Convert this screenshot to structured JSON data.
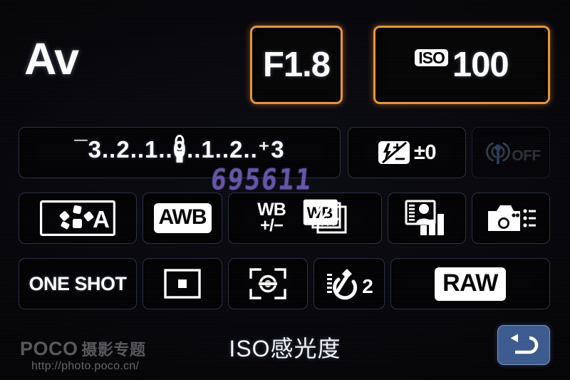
{
  "screen": {
    "device": "camera-quick-control-screen",
    "mode_dial": "Av",
    "accent_highlight_color": "#e8923a",
    "cell_border_color": "#2b3048",
    "background_color": "#000000"
  },
  "exposure": {
    "aperture": "F1.8",
    "iso_badge": "ISO",
    "iso_value": "100",
    "meter_scale": "¯3..2..1..0..1..2..⁺3",
    "meter_index": "0",
    "flash_exposure_compensation": "±0",
    "flash_comp_icon": "flash-exposure-compensation-icon"
  },
  "wireless": {
    "icon": "wifi-icon",
    "status": "OFF"
  },
  "settings_grid": {
    "picture_style": {
      "icon": "picture-style-auto-icon",
      "label": "A"
    },
    "white_balance": {
      "icon": "white-balance-badge",
      "label": "AWB"
    },
    "wb_shift": {
      "icon": "wb-correction-icon",
      "line1": "WB",
      "line2": "+/−"
    },
    "wb_bracket": {
      "icon": "wb-bracketing-icon",
      "label": "WB"
    },
    "auto_lighting_optimizer": {
      "icon": "auto-lighting-optimizer-icon"
    },
    "custom_functions": {
      "icon": "camera-custom-functions-icon"
    },
    "af_mode": {
      "label": "ONE SHOT"
    },
    "af_area": {
      "icon": "single-point-af-icon"
    },
    "metering": {
      "icon": "evaluative-metering-icon"
    },
    "drive_mode": {
      "icon": "self-timer-icon",
      "label": "2"
    },
    "image_quality": {
      "label": "RAW"
    }
  },
  "bottom_bar": {
    "hint": "ISO感光度",
    "back_icon": "return-arrow-icon"
  },
  "watermarks": {
    "poco_brand": "POCO",
    "poco_subtitle": "摄影专题",
    "poco_url": "http://photo.poco.cn/",
    "photo_id": "695611"
  }
}
